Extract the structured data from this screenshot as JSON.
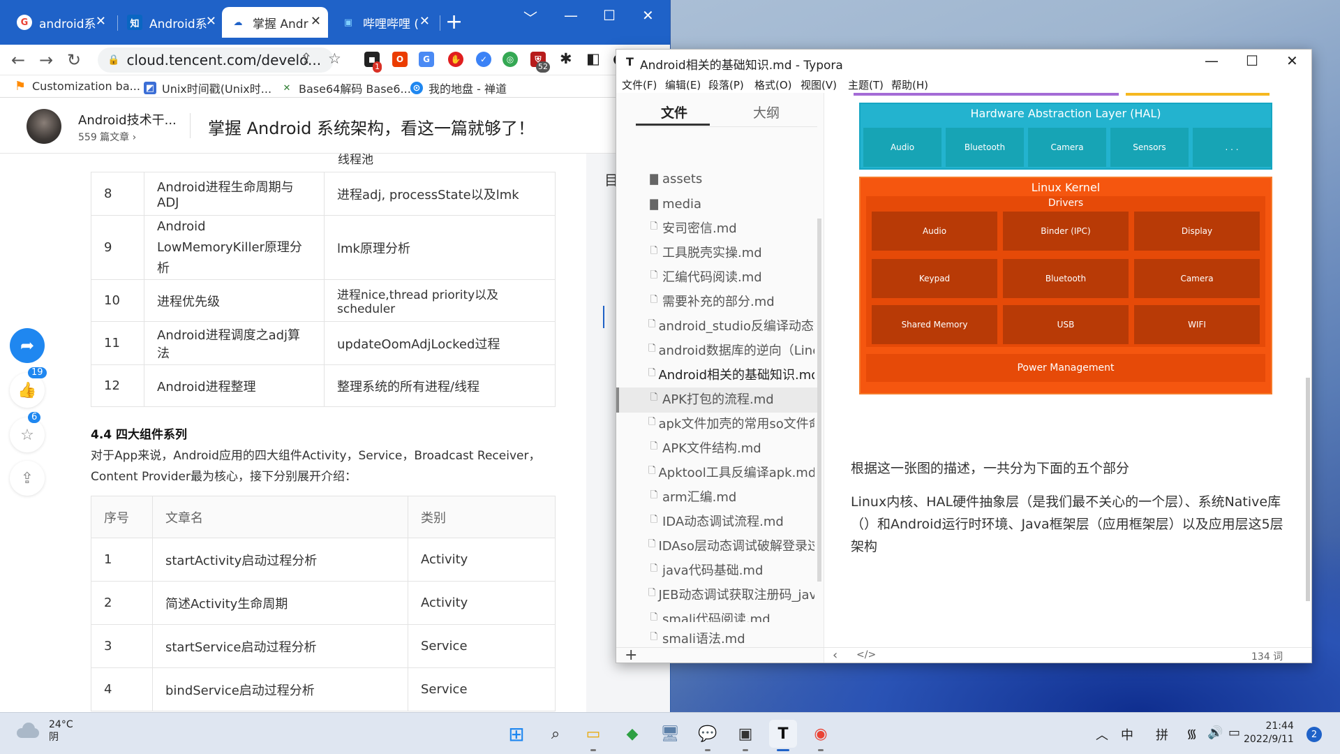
{
  "chrome": {
    "tabs": [
      {
        "title": "android系",
        "icon": "G",
        "color": "#ea4335"
      },
      {
        "title": "Android系",
        "icon": "知",
        "color": "#0a66c2"
      },
      {
        "title": "掌握 Andr",
        "icon": "☁",
        "color": "#1f62c8"
      },
      {
        "title": "哔哩哔哩 (",
        "icon": "▣",
        "color": "#fb7299"
      }
    ],
    "newtab": "+",
    "controls": {
      "minimize": "﹀",
      "restore": "—",
      "maximize": "☐",
      "close": "✕"
    },
    "url": "cloud.tencent.com/develo...",
    "ext_badges": {
      "ext1": "1",
      "ext2": "52"
    },
    "bookmarks": [
      "Customization ba...",
      "Unix时间戳(Unix时...",
      "Base64解码 Base6...",
      "我的地盘 - 禅道"
    ]
  },
  "article": {
    "author": "Android技术干...",
    "article_count": "559 篇文章 ›",
    "title": "掌握 Android 系统架构，看这一篇就够了！",
    "toc_char": "目",
    "table1_top_fragment": "线程池",
    "table1": [
      {
        "num": "8",
        "name": "Android进程生命周期与ADJ",
        "desc": "进程adj, processState以及lmk"
      },
      {
        "num": "9",
        "name": "Android LowMemoryKiller原理分析",
        "desc": "lmk原理分析"
      },
      {
        "num": "10",
        "name": "进程优先级",
        "desc": "进程nice,thread priority以及scheduler"
      },
      {
        "num": "11",
        "name": "Android进程调度之adj算法",
        "desc": "updateOomAdjLocked过程"
      },
      {
        "num": "12",
        "name": "Android进程整理",
        "desc": "整理系统的所有进程/线程"
      }
    ],
    "section_title": "4.4 四大组件系列",
    "section_text": "对于App来说，Android应用的四大组件Activity，Service，Broadcast Receiver，Content Provider最为核心，接下分别展开介绍：",
    "table2_headers": [
      "序号",
      "文章名",
      "类别"
    ],
    "table2": [
      {
        "num": "1",
        "name": "startActivity启动过程分析",
        "cat": "Activity"
      },
      {
        "num": "2",
        "name": "简述Activity生命周期",
        "cat": "Activity"
      },
      {
        "num": "3",
        "name": "startService启动过程分析",
        "cat": "Service"
      },
      {
        "num": "4",
        "name": "bindService启动过程分析",
        "cat": "Service"
      }
    ],
    "like_count": "19",
    "fav_count": "6"
  },
  "typora": {
    "window_title": "Android相关的基础知识.md - Typora",
    "menu": [
      "文件(F)",
      "编辑(E)",
      "段落(P)",
      "格式(O)",
      "视图(V)",
      "主题(T)",
      "帮助(H)"
    ],
    "sidebar_tabs": [
      "文件",
      "大纲"
    ],
    "files": [
      {
        "name": "assets",
        "type": "folder"
      },
      {
        "name": "media",
        "type": "folder"
      },
      {
        "name": "安司密信.md",
        "type": "file"
      },
      {
        "name": "工具脱壳实操.md",
        "type": "file"
      },
      {
        "name": "汇编代码阅读.md",
        "type": "file"
      },
      {
        "name": "需要补充的部分.md",
        "type": "file"
      },
      {
        "name": "android_studio反编译动态调",
        "type": "file"
      },
      {
        "name": "android数据库的逆向（Line）",
        "type": "file"
      },
      {
        "name": "Android相关的基础知识.md",
        "type": "file"
      },
      {
        "name": "APK打包的流程.md",
        "type": "file"
      },
      {
        "name": "apk文件加壳的常用so文件命",
        "type": "file"
      },
      {
        "name": "APK文件结构.md",
        "type": "file"
      },
      {
        "name": "Apktool工具反编译apk.md",
        "type": "file"
      },
      {
        "name": "arm汇编.md",
        "type": "file"
      },
      {
        "name": "IDA动态调试流程.md",
        "type": "file"
      },
      {
        "name": "IDAso层动态调试破解登录过",
        "type": "file"
      },
      {
        "name": "java代码基础.md",
        "type": "file"
      },
      {
        "name": "JEB动态调试获取注册码_java",
        "type": "file"
      },
      {
        "name": "smali代码阅读.md",
        "type": "file"
      },
      {
        "name": "smali语法.md",
        "type": "file"
      }
    ],
    "diagram": {
      "hal_title": "Hardware Abstraction Layer (HAL)",
      "hal_items": [
        "Audio",
        "Bluetooth",
        "Camera",
        "Sensors",
        ". . ."
      ],
      "kernel_title": "Linux Kernel",
      "drivers_title": "Drivers",
      "drivers": [
        "Audio",
        "Binder (IPC)",
        "Display",
        "Keypad",
        "Bluetooth",
        "Camera",
        "Shared Memory",
        "USB",
        "WIFI"
      ],
      "power": "Power Management"
    },
    "paragraph1": "根据这一张图的描述，一共分为下面的五个部分",
    "paragraph2": "Linux内核、HAL硬件抽象层（是我们最不关心的一个层）、系统Native库（）和Android运行时环境、Java框架层（应用框架层）以及应用层这5层架构",
    "word_count": "134 词"
  },
  "taskbar": {
    "temperature": "24°C",
    "weather": "阴",
    "ime1": "中",
    "ime2": "拼",
    "time": "21:44",
    "date": "2022/9/11",
    "notifications": "2"
  }
}
